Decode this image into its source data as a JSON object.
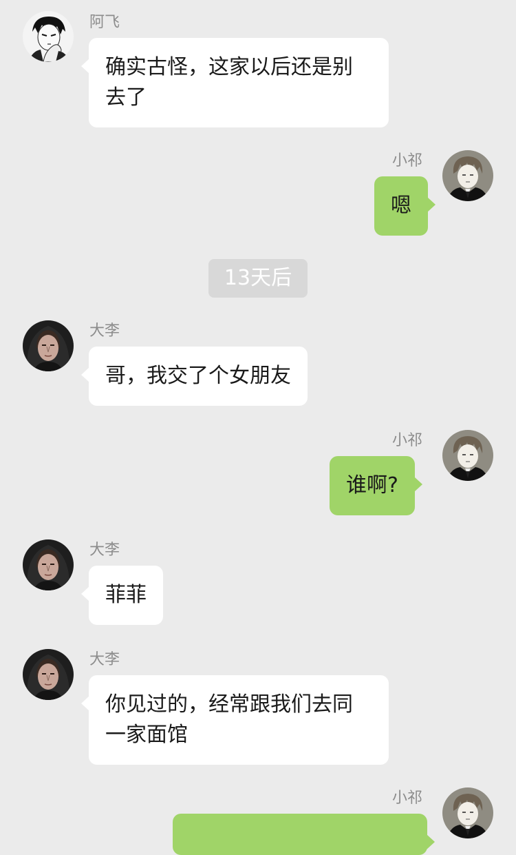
{
  "messages": [
    {
      "sender": "阿飞",
      "text": "确实古怪，这家以后还是别去了"
    },
    {
      "sender": "小祁",
      "text": "嗯"
    },
    {
      "sender": "大李",
      "text": "哥，我交了个女朋友"
    },
    {
      "sender": "小祁",
      "text": "谁啊?"
    },
    {
      "sender": "大李",
      "text": "菲菲"
    },
    {
      "sender": "大李",
      "text": "你见过的，经常跟我们去同一家面馆"
    },
    {
      "sender": "小祁",
      "text": ""
    }
  ],
  "time_divider": "13天后",
  "colors": {
    "background": "#ebebeb",
    "incoming_bubble": "#ffffff",
    "outgoing_bubble": "#a0d468",
    "name_text": "#8c8c8c",
    "divider_bg": "#d8d8d8"
  },
  "avatars": {
    "afei": "manga-man-avatar",
    "xiaoqi": "anime-boy-avatar",
    "dali": "hooded-man-avatar"
  }
}
